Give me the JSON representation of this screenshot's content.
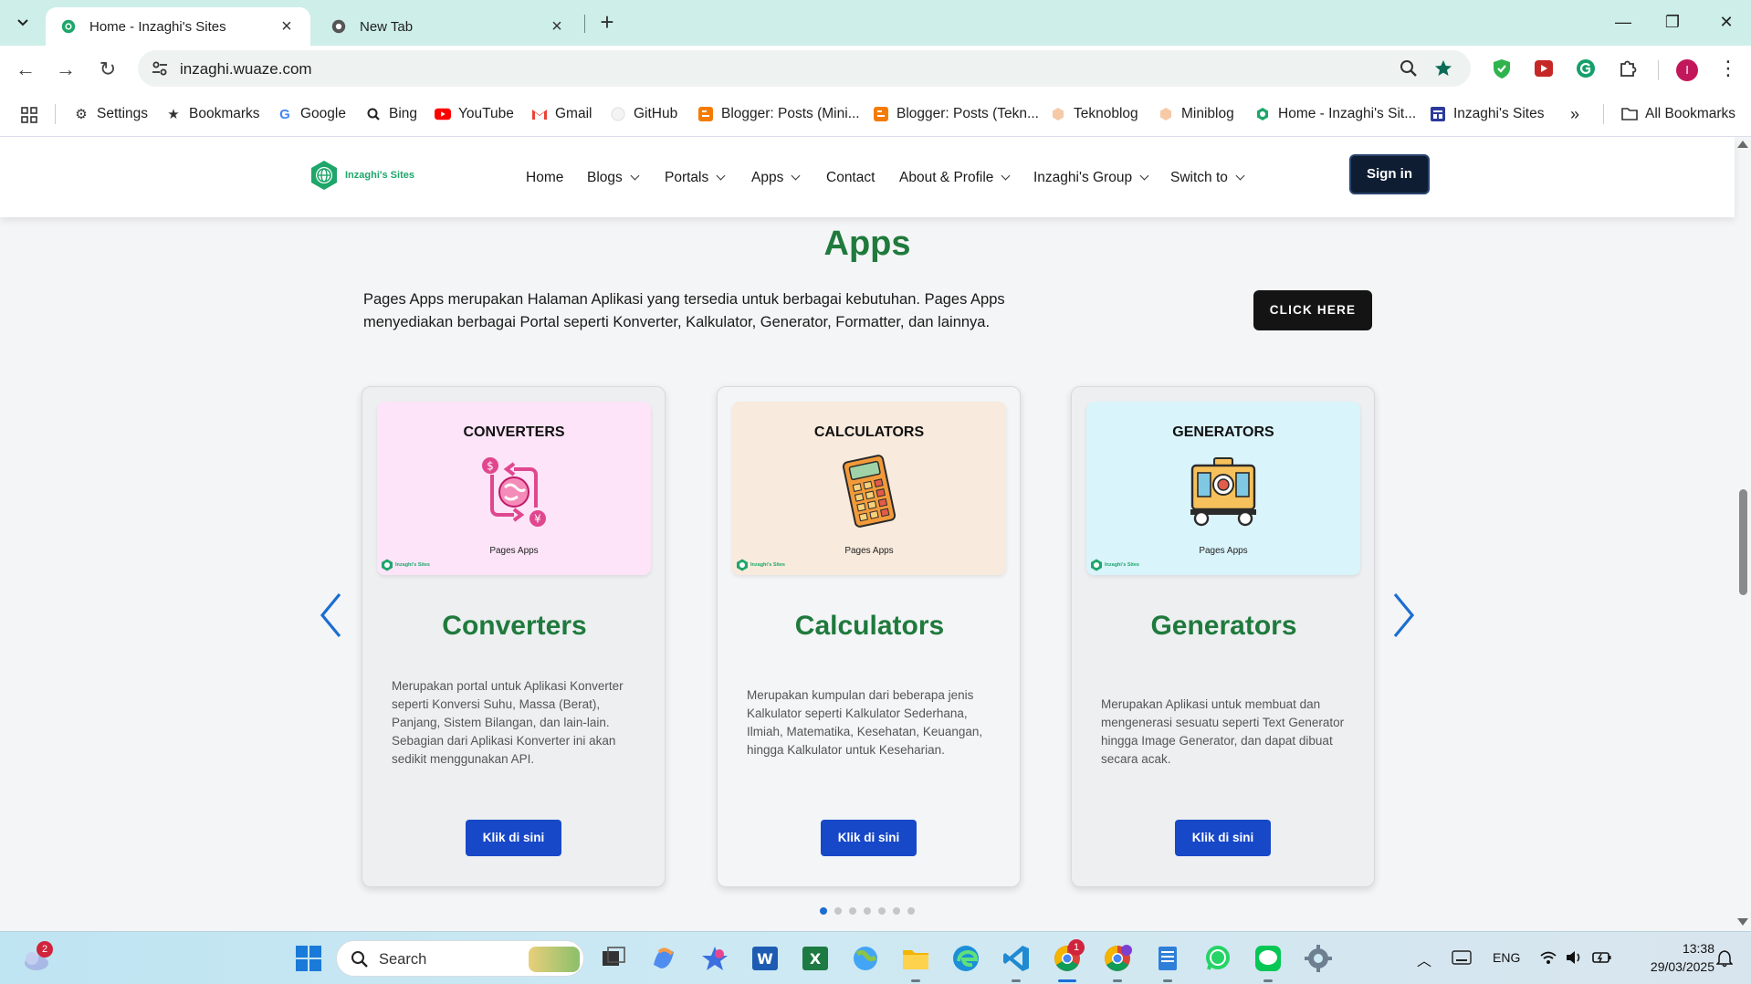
{
  "browser": {
    "tabs": [
      {
        "title": "Home - Inzaghi's Sites",
        "active": true
      },
      {
        "title": "New Tab",
        "active": false
      }
    ],
    "url": "inzaghi.wuaze.com",
    "profile_initial": "I",
    "bookmarks": [
      {
        "label": "Settings",
        "icon": "gear-icon"
      },
      {
        "label": "Bookmarks",
        "icon": "star-icon"
      },
      {
        "label": "Google",
        "icon": "google-icon"
      },
      {
        "label": "Bing",
        "icon": "bing-search-icon"
      },
      {
        "label": "YouTube",
        "icon": "youtube-icon"
      },
      {
        "label": "Gmail",
        "icon": "gmail-icon"
      },
      {
        "label": "GitHub",
        "icon": "github-icon"
      },
      {
        "label": "Blogger: Posts (Mini...",
        "icon": "blogger-icon"
      },
      {
        "label": "Blogger: Posts (Tekn...",
        "icon": "blogger-icon"
      },
      {
        "label": "Teknoblog",
        "icon": "hexagon-icon"
      },
      {
        "label": "Miniblog",
        "icon": "hexagon-icon"
      },
      {
        "label": "Home - Inzaghi's Sit...",
        "icon": "globe-icon"
      },
      {
        "label": "Inzaghi's Sites",
        "icon": "site-icon"
      }
    ],
    "all_bookmarks": "All Bookmarks"
  },
  "site": {
    "logo_text": "Inzaghi's Sites",
    "nav": [
      "Home",
      "Blogs",
      "Portals",
      "Apps",
      "Contact",
      "About & Profile",
      "Inzaghi's Group",
      "Switch to"
    ],
    "signin": "Sign in",
    "accent": "#1f7a3c"
  },
  "section": {
    "title": "Apps",
    "description": "Pages Apps merupakan Halaman Aplikasi yang tersedia untuk berbagai kebutuhan. Pages Apps menyediakan berbagai Portal seperti Konverter, Kalkulator, Generator, Formatter, dan lainnya.",
    "cta": "CLICK HERE"
  },
  "cards": [
    {
      "image_title": "CONVERTERS",
      "image_sub": "Pages Apps",
      "image_logo": "Inzaghi's Sites",
      "image_bg": "#fde4f8",
      "icon": "currency-exchange-icon",
      "title": "Converters",
      "description": "Merupakan portal untuk Aplikasi Konverter seperti Konversi Suhu, Massa (Berat), Panjang, Sistem Bilangan, dan lain-lain. Sebagian dari Aplikasi Konverter ini akan sedikit menggunakan API.",
      "button": "Klik di sini"
    },
    {
      "image_title": "CALCULATORS",
      "image_sub": "Pages Apps",
      "image_logo": "Inzaghi's Sites",
      "image_bg": "#f8eadc",
      "icon": "calculator-icon",
      "title": "Calculators",
      "description": "Merupakan kumpulan dari beberapa jenis Kalkulator seperti Kalkulator Sederhana, Ilmiah, Matematika, Kesehatan, Keuangan, hingga Kalkulator untuk Keseharian.",
      "button": "Klik di sini"
    },
    {
      "image_title": "GENERATORS",
      "image_sub": "Pages Apps",
      "image_logo": "Inzaghi's Sites",
      "image_bg": "#d9f4fb",
      "icon": "generator-icon",
      "title": "Generators",
      "description": "Merupakan Aplikasi untuk membuat dan mengenerasi sesuatu seperti Text Generator hingga Image Generator, dan dapat dibuat secara acak.",
      "button": "Klik di sini"
    }
  ],
  "carousel": {
    "active_dot": 1,
    "dot_count": 7
  },
  "taskbar": {
    "search_placeholder": "Search",
    "weather_badge": "2",
    "chrome_badge": "1",
    "language": "ENG",
    "time": "13:38",
    "date": "29/03/2025"
  }
}
